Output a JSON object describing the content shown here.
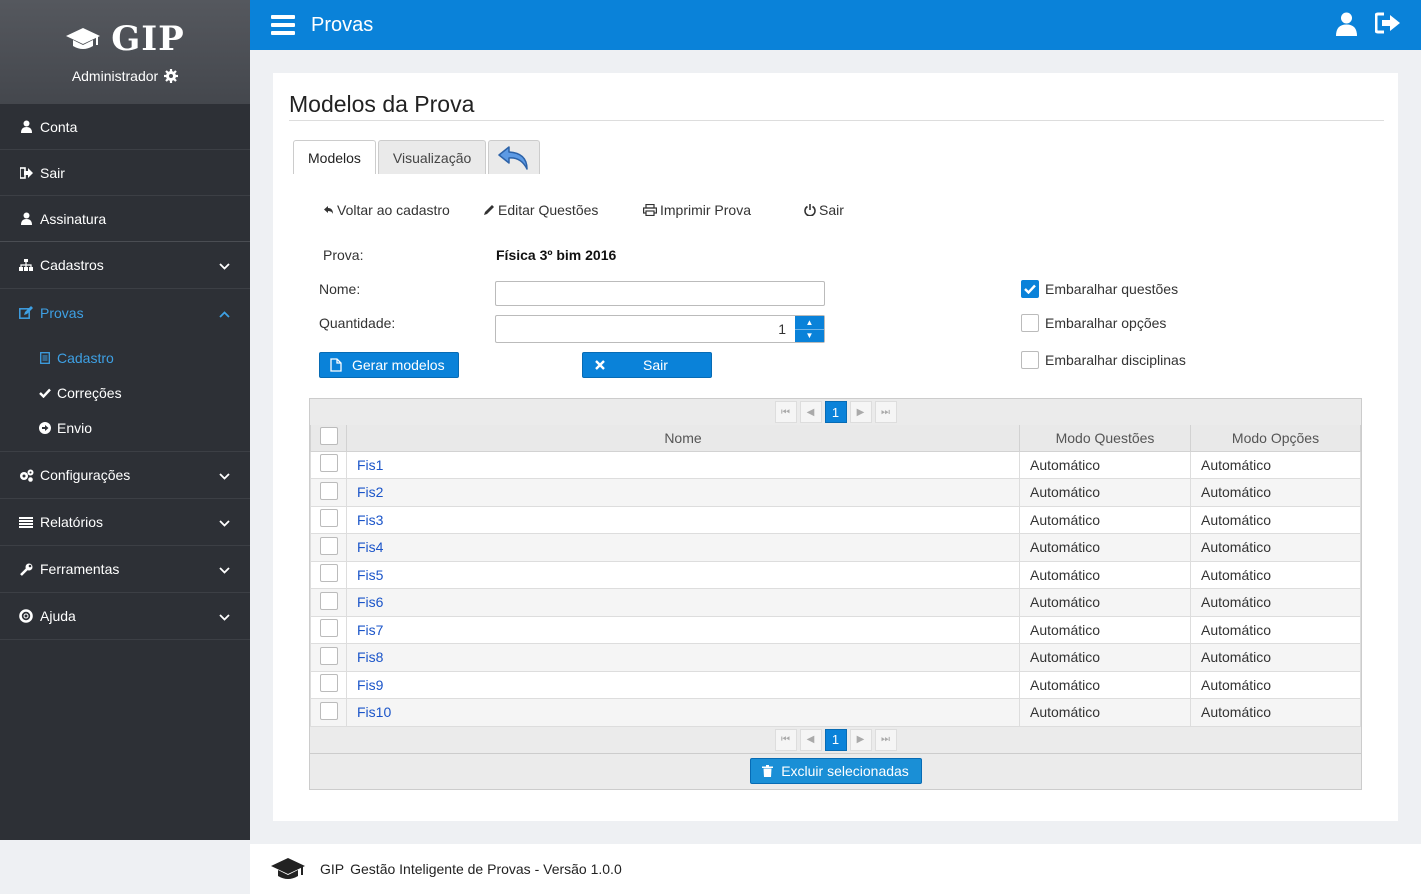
{
  "brand": {
    "name": "GIP",
    "admin": "Administrador"
  },
  "sidebar": {
    "items": [
      {
        "label": "Conta"
      },
      {
        "label": "Sair"
      },
      {
        "label": "Assinatura"
      },
      {
        "label": "Cadastros"
      },
      {
        "label": "Provas"
      },
      {
        "label": "Configurações"
      },
      {
        "label": "Relatórios"
      },
      {
        "label": "Ferramentas"
      },
      {
        "label": "Ajuda"
      }
    ],
    "provas_sub": [
      {
        "label": "Cadastro"
      },
      {
        "label": "Correções"
      },
      {
        "label": "Envio"
      }
    ]
  },
  "header": {
    "title": "Provas"
  },
  "page": {
    "title": "Modelos da Prova",
    "tabs": [
      {
        "label": "Modelos"
      },
      {
        "label": "Visualização"
      }
    ],
    "links": {
      "back": "Voltar ao cadastro",
      "edit": "Editar Questões",
      "print": "Imprimir Prova",
      "exit": "Sair"
    },
    "form": {
      "prova_label": "Prova:",
      "prova_value": "Física 3º bim 2016",
      "nome_label": "Nome:",
      "nome_value": "",
      "quantidade_label": "Quantidade:",
      "quantidade_value": "1",
      "gerar_label": "Gerar modelos",
      "sair_label": "Sair",
      "opts": [
        {
          "label": "Embaralhar questões",
          "checked": true
        },
        {
          "label": "Embaralhar opções",
          "checked": false
        },
        {
          "label": "Embaralhar disciplinas",
          "checked": false
        }
      ]
    },
    "grid": {
      "page": "1",
      "columns": [
        "Nome",
        "Modo Questões",
        "Modo Opções"
      ],
      "rows": [
        {
          "nome": "Fis1",
          "mq": "Automático",
          "mo": "Automático"
        },
        {
          "nome": "Fis2",
          "mq": "Automático",
          "mo": "Automático"
        },
        {
          "nome": "Fis3",
          "mq": "Automático",
          "mo": "Automático"
        },
        {
          "nome": "Fis4",
          "mq": "Automático",
          "mo": "Automático"
        },
        {
          "nome": "Fis5",
          "mq": "Automático",
          "mo": "Automático"
        },
        {
          "nome": "Fis6",
          "mq": "Automático",
          "mo": "Automático"
        },
        {
          "nome": "Fis7",
          "mq": "Automático",
          "mo": "Automático"
        },
        {
          "nome": "Fis8",
          "mq": "Automático",
          "mo": "Automático"
        },
        {
          "nome": "Fis9",
          "mq": "Automático",
          "mo": "Automático"
        },
        {
          "nome": "Fis10",
          "mq": "Automático",
          "mo": "Automático"
        }
      ],
      "delete_label": "Excluir selecionadas"
    }
  },
  "footer": {
    "brand": "GIP",
    "text": "Gestão Inteligente de Provas - Versão 1.0.0"
  },
  "colors": {
    "primary": "#0a82d9",
    "sidebar": "#2d3036",
    "active": "#3ea0e4",
    "link": "#1b55c9"
  }
}
